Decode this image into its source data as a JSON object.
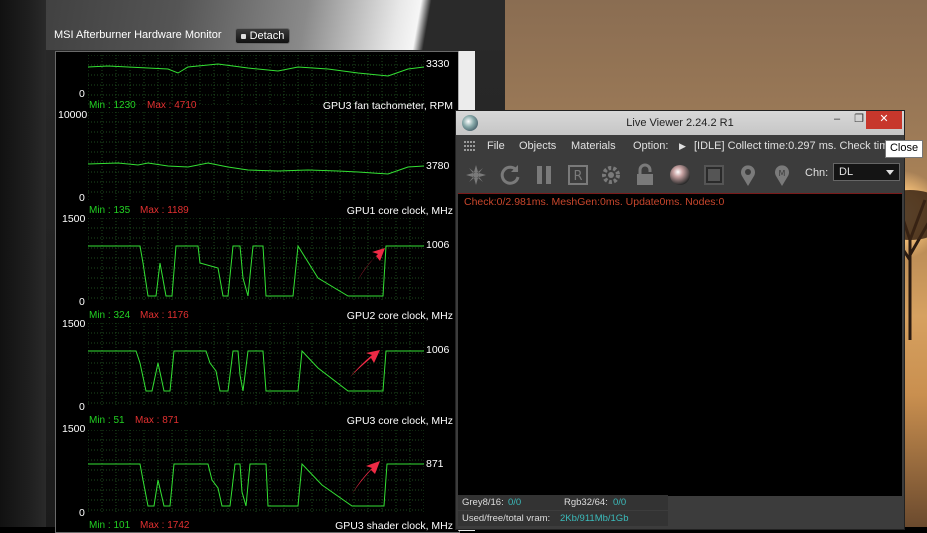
{
  "afterburner": {
    "title": "MSI Afterburner Hardware Monitor",
    "detach_label": "Detach",
    "graphs": [
      {
        "name": "GPU3 fan tachometer, RPM",
        "top_scale": "",
        "bottom_scale": "0",
        "current": "3330",
        "min_label": "Min : 1230",
        "max_label": "Max : 4710"
      },
      {
        "name": "GPU1 core clock, MHz",
        "top_scale": "10000",
        "bottom_scale": "0",
        "current": "3780",
        "min_label": "Min : 135",
        "max_label": "Max : 1189"
      },
      {
        "name": "GPU2 core clock, MHz",
        "top_scale": "1500",
        "bottom_scale": "0",
        "current": "1006",
        "min_label": "Min : 324",
        "max_label": "Max : 1176"
      },
      {
        "name": "GPU3 core clock, MHz",
        "top_scale": "1500",
        "bottom_scale": "0",
        "current": "1006",
        "min_label": "Min : 51",
        "max_label": "Max : 871"
      },
      {
        "name": "GPU3 shader clock, MHz",
        "top_scale": "1500",
        "bottom_scale": "0",
        "current": "871",
        "min_label": "Min : 101",
        "max_label": "Max : 1742"
      }
    ]
  },
  "live_viewer": {
    "title": "Live Viewer 2.24.2 R1",
    "window_buttons": {
      "minimize": "–",
      "maximize": "❐",
      "close": "✕"
    },
    "menu": [
      "File",
      "Objects",
      "Materials",
      "Option:"
    ],
    "status_text": "[IDLE] Collect time:0.297 ms.  Check tim",
    "channel_label": "Chn:",
    "channel_value": "DL",
    "render_status": "Check:0/2.981ms. MeshGen:0ms. Update0ms. Nodes:0",
    "info": {
      "grey_label": "Grey8/16:",
      "grey_value": "0/0",
      "rgb_label": "Rgb32/64:",
      "rgb_value": "0/0",
      "vram_label": "Used/free/total vram:",
      "vram_value": "2Kb/911Mb/1Gb"
    },
    "toolbar_icons": [
      "render-icon",
      "refresh-icon",
      "pause-icon",
      "region-render-icon",
      "settings-icon",
      "lock-icon",
      "material-sphere-icon",
      "frame-icon",
      "pin-icon",
      "pin-marker-icon"
    ]
  },
  "tooltip": {
    "text": "Close"
  },
  "colors": {
    "graph_line": "#33e033",
    "min_text": "#22d022",
    "max_text": "#e23030",
    "status_orange": "#c8462c",
    "close_red": "#c7372c",
    "annotation_arrow": "#ee2a45"
  }
}
